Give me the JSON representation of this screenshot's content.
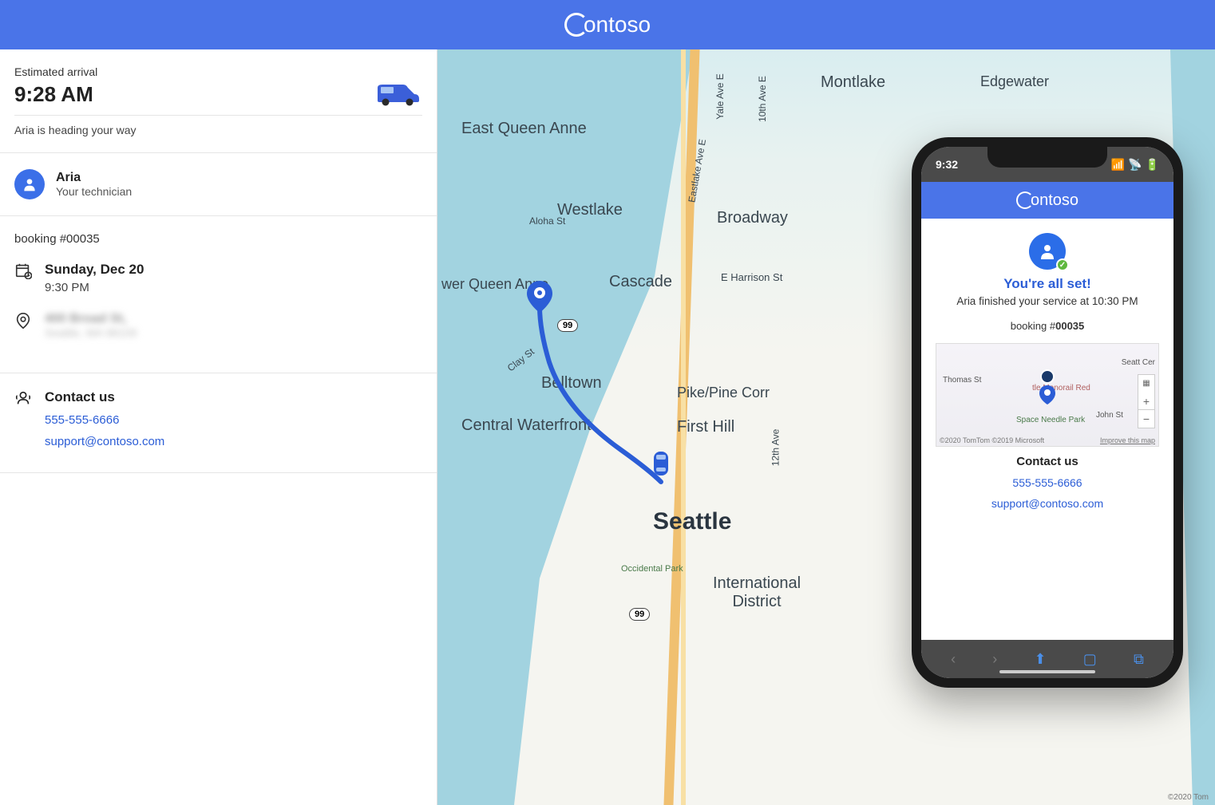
{
  "header": {
    "brand": "ontoso"
  },
  "sidebar": {
    "eta_label": "Estimated arrival",
    "eta_time": "9:28 AM",
    "status": "Aria is heading your way",
    "technician": {
      "name": "Aria",
      "role": "Your technician"
    },
    "booking_label": "booking #00035",
    "date": "Sunday, Dec 20",
    "time": "9:30 PM",
    "address_line1": "400 Broad St,",
    "address_line2": "Seattle, WA 98109",
    "contact": {
      "title": "Contact us",
      "phone": "555-555-6666",
      "email": "support@contoso.com"
    }
  },
  "map": {
    "labels": {
      "montlake": "Montlake",
      "edgewater": "Edgewater",
      "eqnanne": "East Queen Anne",
      "westlake": "Westlake",
      "broadway": "Broadway",
      "lqa": "wer Queen Anne",
      "cascade": "Cascade",
      "belltown": "Belltown",
      "pikepine": "Pike/Pine Corr",
      "cw": "Central Waterfront",
      "firsthill": "First Hill",
      "seattle": "Seattle",
      "intl": "International District",
      "occidental": "Occidental Park",
      "aloha": "Aloha St",
      "harrison": "E Harrison St",
      "clay": "Clay St",
      "yale": "Yale Ave E",
      "eastlake": "Eastlake Ave E",
      "spaceneedle": "Space Needle Park",
      "tenth": "10th Ave E",
      "twelfth": "12th Ave"
    },
    "route_hwy_1": "99",
    "route_hwy_2": "99",
    "attrib_outer": "©2020 Tom"
  },
  "phone": {
    "time": "9:32",
    "brand": "ontoso",
    "all_set": "You're all set!",
    "finished": "Aria finished your service at 10:30 PM",
    "booking_prefix": "booking #",
    "booking_num": "00035",
    "map": {
      "thomas": "Thomas St",
      "spaceneedle": "Space Needle Park",
      "john": "John St",
      "monorail": "tle Monorail Red",
      "seatt": "Seatt Cer",
      "attrib": "©2020 TomTom ©2019 Microsoft",
      "improve": "Improve this map"
    },
    "contact": {
      "title": "Contact us",
      "phone": "555-555-6666",
      "email": "support@contoso.com"
    }
  }
}
